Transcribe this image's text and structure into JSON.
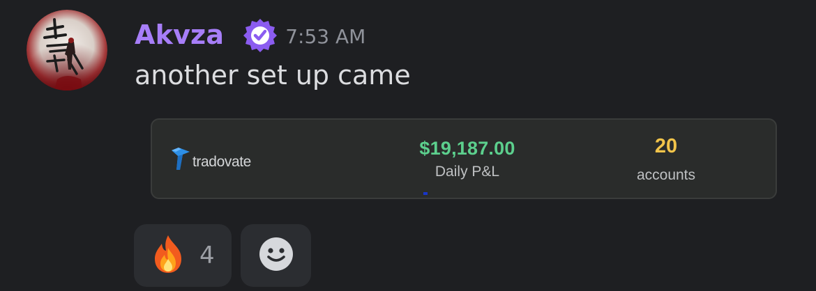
{
  "message": {
    "author": {
      "username": "Akvza",
      "name_color": "#a77ef8",
      "verified_icon": "verified-badge-icon",
      "avatar_icon": "avatar-image",
      "avatar_glyphs": "上 弦"
    },
    "timestamp": "7:53 AM",
    "content": "another set up came"
  },
  "embed": {
    "brand": {
      "icon": "tradovate-logo-icon",
      "name": "tradovate"
    },
    "pnl": {
      "value": "$19,187.00",
      "label": "Daily P&L",
      "color": "#5ccf8d"
    },
    "accounts": {
      "value": "20",
      "label": "accounts",
      "color": "#f2c44a"
    }
  },
  "reactions": [
    {
      "emoji": "fire-emoji-icon",
      "count": "4"
    },
    {
      "emoji": "add-reaction-smiley-icon"
    }
  ]
}
